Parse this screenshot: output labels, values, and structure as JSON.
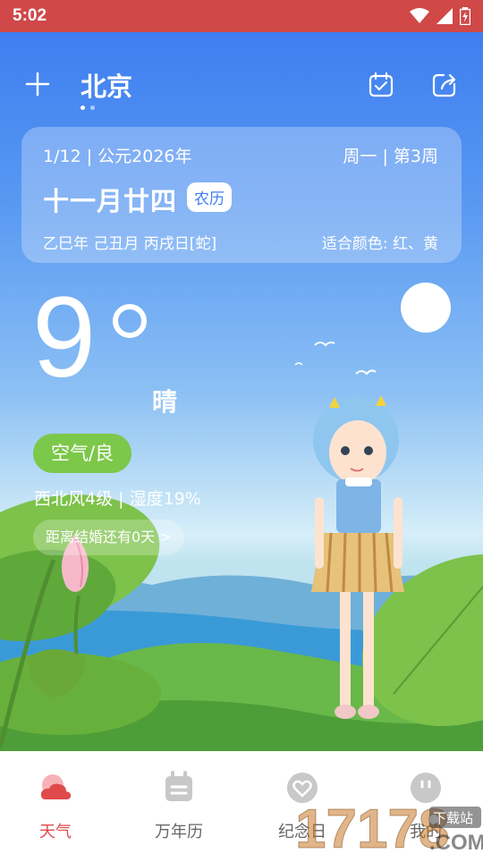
{
  "status_bar": {
    "time": "5:02"
  },
  "header": {
    "city": "北京",
    "page_dots": 2,
    "active_dot": 0
  },
  "date_card": {
    "solar_date": "1/12 | 公元2026年",
    "weekday_week": "周一 | 第3周",
    "lunar_date": "十一月廿四",
    "lunar_tag": "农历",
    "ganzhi": "乙巳年 己丑月 丙戌日[蛇]",
    "lucky_colors": "适合颜色: 红、黄"
  },
  "weather": {
    "temperature": "9",
    "condition": "晴",
    "air_quality": "空气/良",
    "wind_humidity": "西北风4级 | 湿度19%",
    "countdown": "距离结婚还有0天 >"
  },
  "bottom_nav": {
    "items": [
      {
        "label": "天气",
        "icon": "cloud-icon",
        "active": true
      },
      {
        "label": "万年历",
        "icon": "calendar-icon",
        "active": false
      },
      {
        "label": "纪念日",
        "icon": "heart-icon",
        "active": false
      },
      {
        "label": "我的",
        "icon": "profile-icon",
        "active": false
      }
    ]
  },
  "watermark": {
    "text": "17178.COM",
    "badge": "下载站"
  },
  "colors": {
    "status_bar": "#d04848",
    "accent_red": "#e04a4a",
    "air_good": "#7cc84a",
    "sky": "#3e7ef0"
  }
}
